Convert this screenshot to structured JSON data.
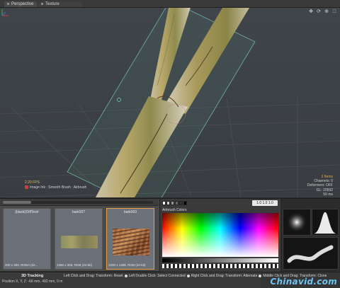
{
  "tabs": [
    {
      "label": "Perspective"
    },
    {
      "label": "Texture"
    }
  ],
  "viewport": {
    "icons": [
      "orbit-icon",
      "move-icon",
      "zoom-icon",
      "maximize-icon"
    ],
    "stats": {
      "items": "2 Items",
      "channels": "Channels: 0",
      "deformers": "Deformers: OFF",
      "gl": "GL: 20592",
      "time": "50 ms"
    },
    "hud": {
      "fps": "2.20 FPS",
      "ink": "Image Ink : Smooth Brush : Airbrush"
    }
  },
  "clips": [
    {
      "title": "(blank)DiffTex#",
      "info": "400 x 400, RGBA (32...",
      "selected": false
    },
    {
      "title": "bark007",
      "info": "1366 x 326, RGB (24-bit)",
      "selected": false
    },
    {
      "title": "bark003",
      "info": "2200 x 1468, RGB (24-bit)",
      "selected": true
    }
  ],
  "color_panel": {
    "values": "1.0  1.0  1.0",
    "label": "Airbrush Colors"
  },
  "statusbar": {
    "tool_title": "3D Tracking",
    "position": "Position X, Y, Z:  -66 mm, 492 mm, 0 m",
    "hint_parts": [
      "Left Click and Drag: Transform: Reset",
      "Left Double Click: Select Connected",
      "Right Click and Drag: Transform: Alternate",
      "Middle Click and Drag: Transform: Clone"
    ]
  },
  "watermark": "Chinavid.com",
  "colors": {
    "accent_orange": "#e8a34a",
    "viewport_bg": "#3d4247",
    "watermark_blue": "#6ec3f0"
  }
}
